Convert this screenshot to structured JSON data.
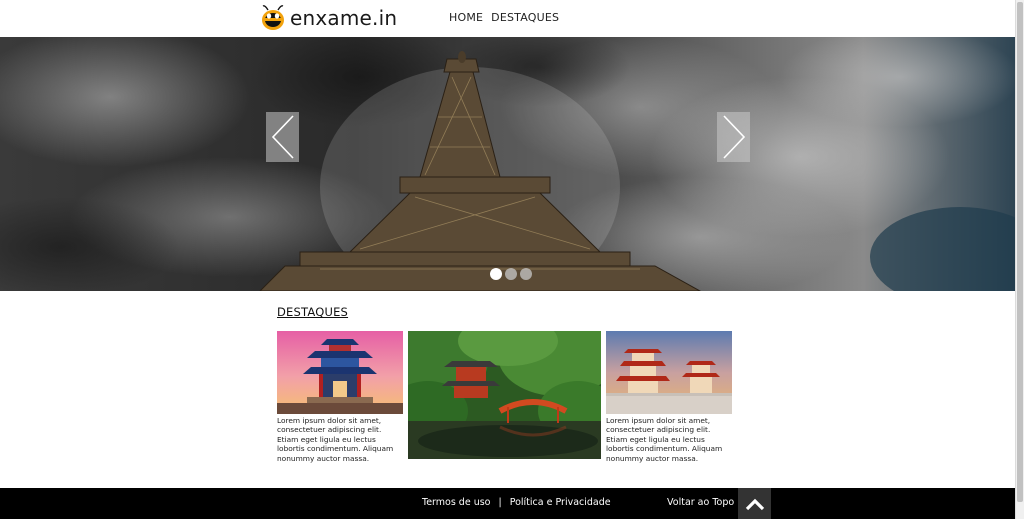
{
  "header": {
    "logo_text": "enxame.in",
    "logo_icon": "bee-icon",
    "nav": [
      "HOME",
      "DESTAQUES"
    ]
  },
  "hero": {
    "prev_icon": "chevron-left-icon",
    "next_icon": "chevron-right-icon",
    "active_slide": 1,
    "slide_count": 3
  },
  "destaques": {
    "title": "DESTAQUES",
    "cards": [
      {
        "caption": "Lorem ipsum dolor sit amet, consectetuer adipiscing elit. Etiam eget ligula eu lectus lobortis condimentum. Aliquam nonummy auctor massa."
      },
      {
        "caption": ""
      },
      {
        "caption": "Lorem ipsum dolor sit amet, consectetuer adipiscing elit. Etiam eget ligula eu lectus lobortis condimentum. Aliquam nonummy auctor massa."
      }
    ]
  },
  "footer": {
    "terms": "Termos de uso",
    "separator": "|",
    "privacy": "Política e Privacidade",
    "back_to_top": "Voltar ao Topo",
    "back_to_top_icon": "chevron-up-icon"
  },
  "colors": {
    "footer_bg": "#000000",
    "top_button_bg": "#333333"
  }
}
